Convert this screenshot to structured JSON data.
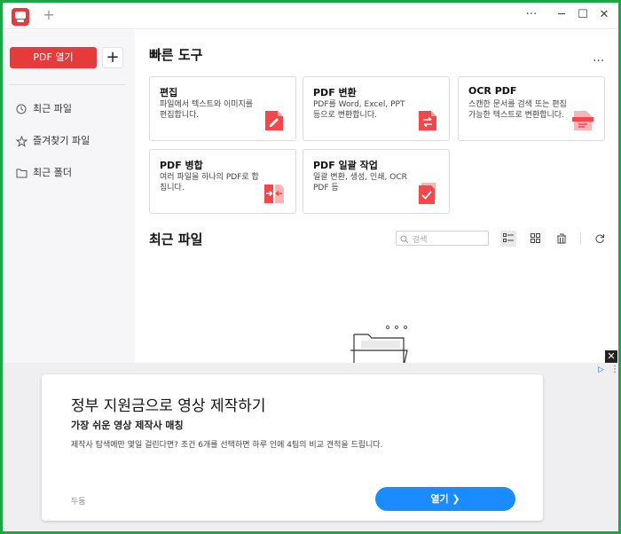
{
  "titlebar": {
    "new_tab": "+",
    "more": "···",
    "minimize": "─",
    "maximize": "☐",
    "close": "✕"
  },
  "sidebar": {
    "open_button": "PDF 열기",
    "add_button": "+",
    "items": [
      {
        "label": "최근 파일",
        "icon": "clock-icon"
      },
      {
        "label": "즐겨찾기 파일",
        "icon": "star-icon"
      },
      {
        "label": "최근 폴더",
        "icon": "folder-icon"
      }
    ]
  },
  "quick_tools": {
    "title": "빠른 도구",
    "more": "...",
    "cards": [
      {
        "title": "편집",
        "desc": "파일에서 텍스트와 이미지를 편집합니다.",
        "icon": "edit-doc-icon"
      },
      {
        "title": "PDF 변환",
        "desc": "PDF를 Word, Excel, PPT 등으로 변환합니다.",
        "icon": "convert-doc-icon"
      },
      {
        "title": "OCR PDF",
        "desc": "스캔한 문서를 검색 또는 편집 가능한 텍스트로 변환합니다.",
        "icon": "ocr-doc-icon"
      },
      {
        "title": "PDF 병합",
        "desc": "여러 파일을 하나의 PDF로 합칩니다.",
        "icon": "merge-doc-icon"
      },
      {
        "title": "PDF 일괄 작업",
        "desc": "일괄 변환, 생성, 인쇄, OCR PDF 등",
        "icon": "batch-doc-icon"
      }
    ]
  },
  "recent": {
    "title": "최근 파일",
    "search_placeholder": "검색"
  },
  "ad": {
    "title": "정부 지원금으로 영상 제작하기",
    "subtitle": "가장 쉬운 영상 제작사 매칭",
    "description": "제작사 탐색에만 몇일 걸린다면? 조건 6개를 선택하면 하루 인에 4팀의 비교 견적을 드립니다.",
    "brand": "두둠",
    "cta": "열기 ❯",
    "close": "✕",
    "adchoice": "▷",
    "kebab": "⋮"
  },
  "colors": {
    "accent": "#e63b3b",
    "frame": "#1aa845",
    "ad_button": "#1a8cff"
  }
}
